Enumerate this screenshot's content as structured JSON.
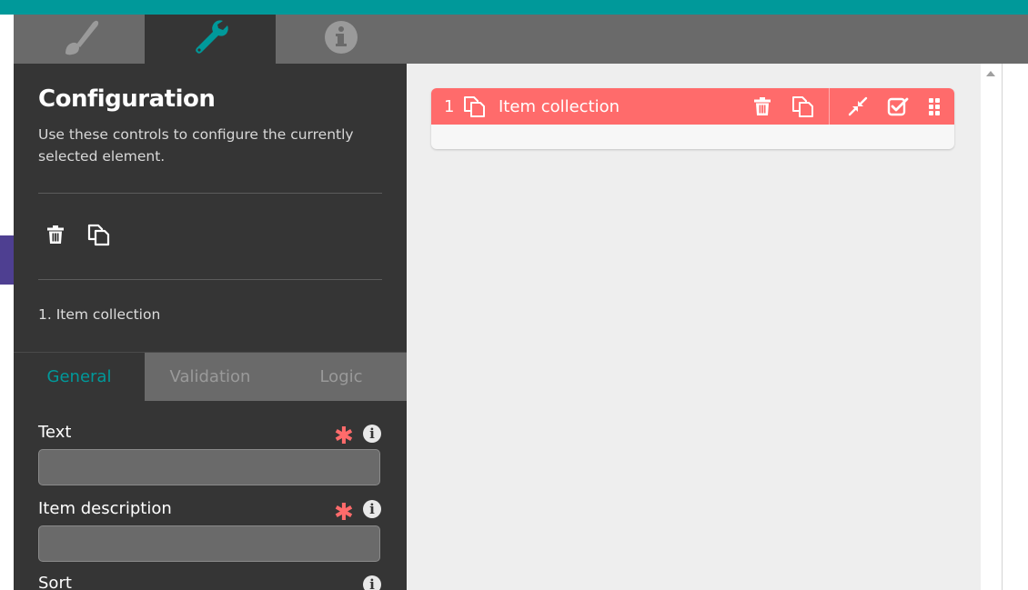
{
  "icon_tabs": [
    {
      "icon": "paintbrush-icon",
      "active": false
    },
    {
      "icon": "wrench-icon",
      "active": true
    },
    {
      "icon": "info-icon",
      "active": false
    }
  ],
  "panel": {
    "title": "Configuration",
    "description": "Use these controls to configure the currently selected element.",
    "breadcrumb": "1. Item collection",
    "actions": [
      "trash-icon",
      "duplicate-icon"
    ]
  },
  "sub_tabs": [
    {
      "label": "General",
      "active": true
    },
    {
      "label": "Validation",
      "active": false
    },
    {
      "label": "Logic",
      "active": false
    }
  ],
  "fields": [
    {
      "label": "Text",
      "required": "✱",
      "value": ""
    },
    {
      "label": "Item description",
      "required": "✱",
      "value": ""
    },
    {
      "label": "Sort"
    }
  ],
  "element": {
    "number": "1",
    "title": "Item collection"
  },
  "colors": {
    "accent": "#00999a",
    "element_header": "#ff6b6b",
    "panel_bg": "#353535",
    "tab_bg": "#6a6a6a",
    "canvas_bg": "#eeeeee",
    "side_tab": "#4e3f91"
  }
}
